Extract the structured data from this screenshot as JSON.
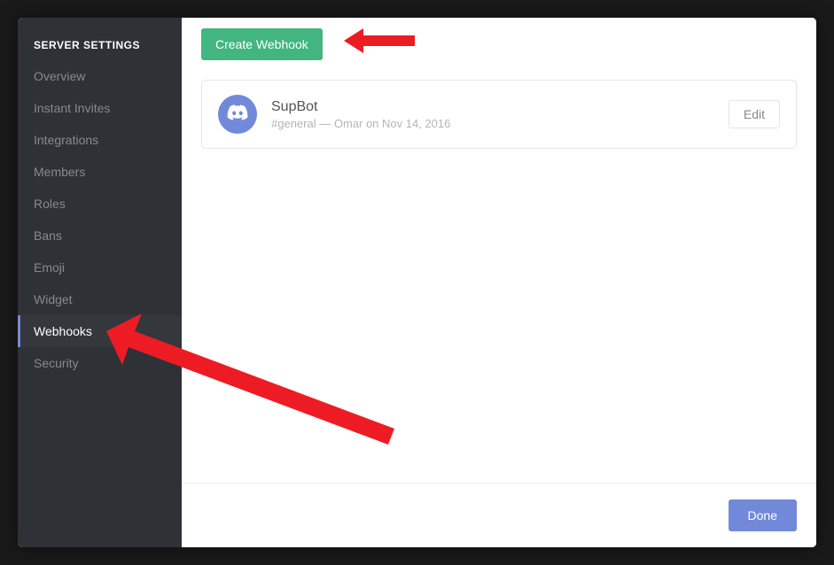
{
  "sidebar": {
    "header": "SERVER SETTINGS",
    "items": [
      {
        "label": "Overview",
        "id": "overview"
      },
      {
        "label": "Instant Invites",
        "id": "instant-invites"
      },
      {
        "label": "Integrations",
        "id": "integrations"
      },
      {
        "label": "Members",
        "id": "members"
      },
      {
        "label": "Roles",
        "id": "roles"
      },
      {
        "label": "Bans",
        "id": "bans"
      },
      {
        "label": "Emoji",
        "id": "emoji"
      },
      {
        "label": "Widget",
        "id": "widget"
      },
      {
        "label": "Webhooks",
        "id": "webhooks"
      },
      {
        "label": "Security",
        "id": "security"
      }
    ],
    "active_index": 8
  },
  "main": {
    "create_button_label": "Create Webhook",
    "webhook": {
      "name": "SupBot",
      "channel": "#general",
      "separator": " — ",
      "author": "Omar",
      "on_word": " on ",
      "date": "Nov 14, 2016",
      "edit_label": "Edit"
    },
    "footer": {
      "done_label": "Done"
    }
  },
  "colors": {
    "accent": "#7289da",
    "green": "#43b581",
    "sidebar_bg": "#2e3136"
  }
}
